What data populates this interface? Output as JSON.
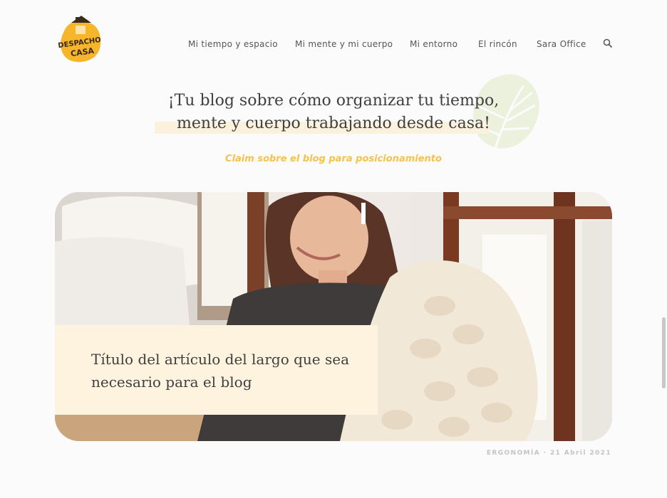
{
  "brand": {
    "logo_text_line1": "DESPACHO",
    "logo_text_line2": "CASA",
    "logo_color": "#f7b52c"
  },
  "nav": {
    "items": [
      {
        "label": "Mi tiempo y espacio"
      },
      {
        "label": "Mi mente y mi cuerpo"
      },
      {
        "label": "Mi entorno"
      },
      {
        "label": "El rincón"
      },
      {
        "label": "Sara Office"
      }
    ],
    "search_icon": "search-icon"
  },
  "hero": {
    "title_line1": "¡Tu blog sobre cómo organizar tu tiempo,",
    "title_line2": "mente y cuerpo trabajando desde casa!",
    "claim": "Claim sobre el blog para posicionamiento"
  },
  "featured": {
    "title": "Título del artículo del largo que sea necesario para el blog",
    "category": "ERGONOMÍA",
    "separator": "·",
    "date": "21 Abril 2021"
  },
  "colors": {
    "accent": "#f5c24c",
    "highlight": "#fbf1dc",
    "caption_bg": "#fdf3de"
  }
}
